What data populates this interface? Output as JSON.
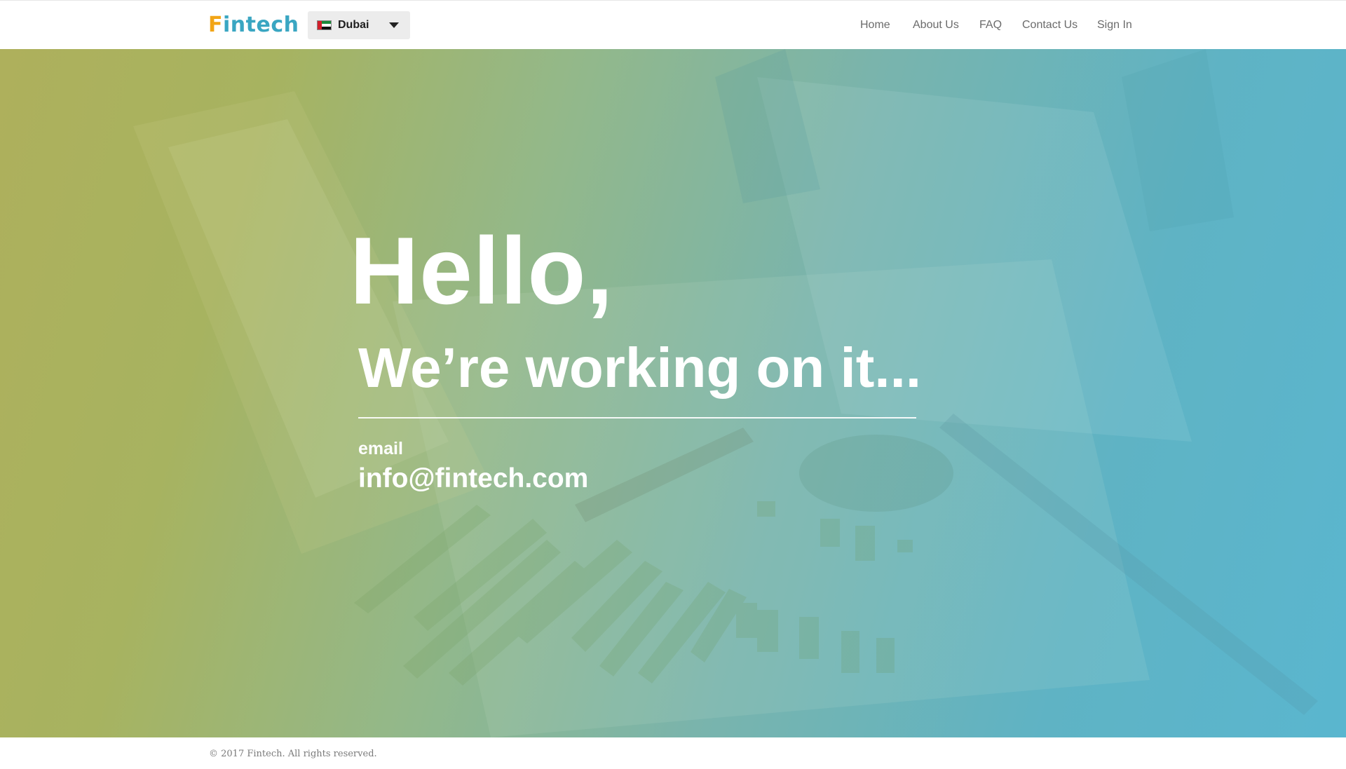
{
  "brand": {
    "logo_first": "F",
    "logo_rest": "intech",
    "primary_color": "#3aa6c2",
    "accent_color": "#f2a516"
  },
  "city_selector": {
    "flag_icon": "uae-flag-icon",
    "selected": "Dubai"
  },
  "nav": {
    "items": [
      {
        "label": "Home"
      },
      {
        "label": "About Us"
      },
      {
        "label": "FAQ"
      },
      {
        "label": "Contact Us"
      },
      {
        "label": "Sign In"
      }
    ]
  },
  "hero": {
    "headline": "Hello,",
    "subheadline": "We’re working on it...",
    "email_label": "email",
    "email": "info@fintech.com",
    "gradient_left": "#aeb05c",
    "gradient_right": "#5ab6cf"
  },
  "footer": {
    "copyright": "© 2017 Fintech. All rights reserved."
  }
}
